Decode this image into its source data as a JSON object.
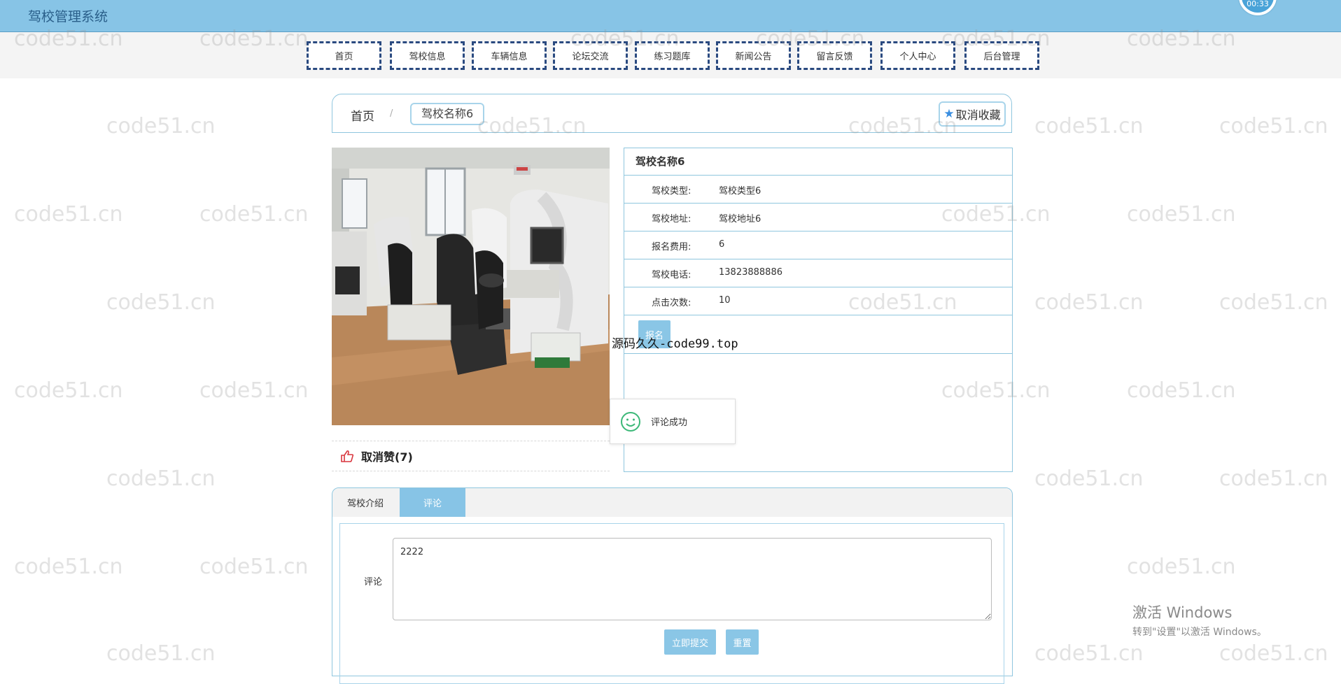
{
  "header": {
    "title": "驾校管理系统",
    "timer": "00:33"
  },
  "nav": {
    "items": [
      {
        "label": "首页"
      },
      {
        "label": "驾校信息"
      },
      {
        "label": "车辆信息"
      },
      {
        "label": "论坛交流"
      },
      {
        "label": "练习题库"
      },
      {
        "label": "新闻公告"
      },
      {
        "label": "留言反馈"
      },
      {
        "label": "个人中心"
      },
      {
        "label": "后台管理"
      }
    ]
  },
  "breadcrumb": {
    "home": "首页",
    "separator": "/",
    "current": "驾校名称6"
  },
  "favorite": {
    "label": "取消收藏",
    "icon": "star-icon"
  },
  "detail": {
    "title": "驾校名称6",
    "rows": [
      {
        "label": "驾校类型:",
        "value": "驾校类型6"
      },
      {
        "label": "驾校地址:",
        "value": "驾校地址6"
      },
      {
        "label": "报名费用:",
        "value": "6"
      },
      {
        "label": "驾校电话:",
        "value": "13823888886"
      },
      {
        "label": "点击次数:",
        "value": "10"
      }
    ],
    "signup_label": "报名"
  },
  "like": {
    "label": "取消赞(7)",
    "icon": "thumbs-up-icon"
  },
  "overlay_text": "源码久久-code99.top",
  "toast": {
    "text": "评论成功",
    "icon": "smile-icon"
  },
  "tabs": [
    {
      "label": "驾校介绍",
      "active": false
    },
    {
      "label": "评论",
      "active": true
    }
  ],
  "comment": {
    "label": "评论",
    "value": "2222",
    "submit_label": "立即提交",
    "reset_label": "重置"
  },
  "watermark": "code51.cn",
  "windows_activation": {
    "line1": "激活 Windows",
    "line2": "转到\"设置\"以激活 Windows。"
  },
  "colors": {
    "header": "#87c4e6",
    "button": "#8ac6e6",
    "nav_border": "#2a4a80"
  }
}
